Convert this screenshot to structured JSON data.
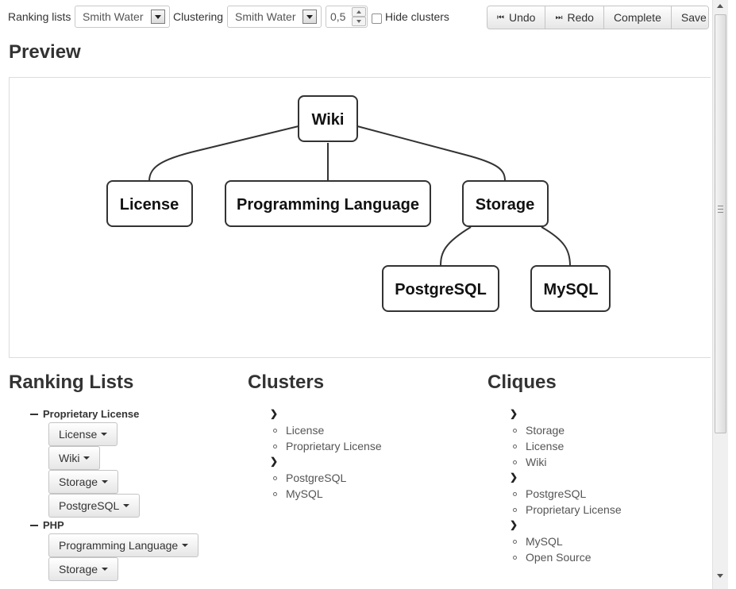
{
  "toolbar": {
    "ranking_label": "Ranking lists",
    "ranking_value": "Smith Water",
    "clustering_label": "Clustering",
    "clustering_value": "Smith Water",
    "threshold_value": "0,5",
    "hide_clusters_label": "Hide clusters",
    "undo_label": "Undo",
    "redo_label": "Redo",
    "complete_label": "Complete",
    "save_label": "Save"
  },
  "preview": {
    "title": "Preview",
    "nodes": {
      "wiki": "Wiki",
      "license": "License",
      "programming_language": "Programming Language",
      "storage": "Storage",
      "postgresql": "PostgreSQL",
      "mysql": "MySQL"
    }
  },
  "ranking": {
    "title": "Ranking Lists",
    "groups": [
      {
        "name": "Proprietary License",
        "items": [
          "License",
          "Wiki",
          "Storage",
          "PostgreSQL"
        ]
      },
      {
        "name": "PHP",
        "items": [
          "Programming Language",
          "Storage"
        ]
      }
    ]
  },
  "clusters": {
    "title": "Clusters",
    "groups": [
      {
        "items": [
          "License",
          "Proprietary License"
        ]
      },
      {
        "items": [
          "PostgreSQL",
          "MySQL"
        ]
      }
    ]
  },
  "cliques": {
    "title": "Cliques",
    "groups": [
      {
        "items": [
          "Storage",
          "License",
          "Wiki"
        ]
      },
      {
        "items": [
          "PostgreSQL",
          "Proprietary License"
        ]
      },
      {
        "items": [
          "MySQL",
          "Open Source"
        ]
      }
    ]
  }
}
